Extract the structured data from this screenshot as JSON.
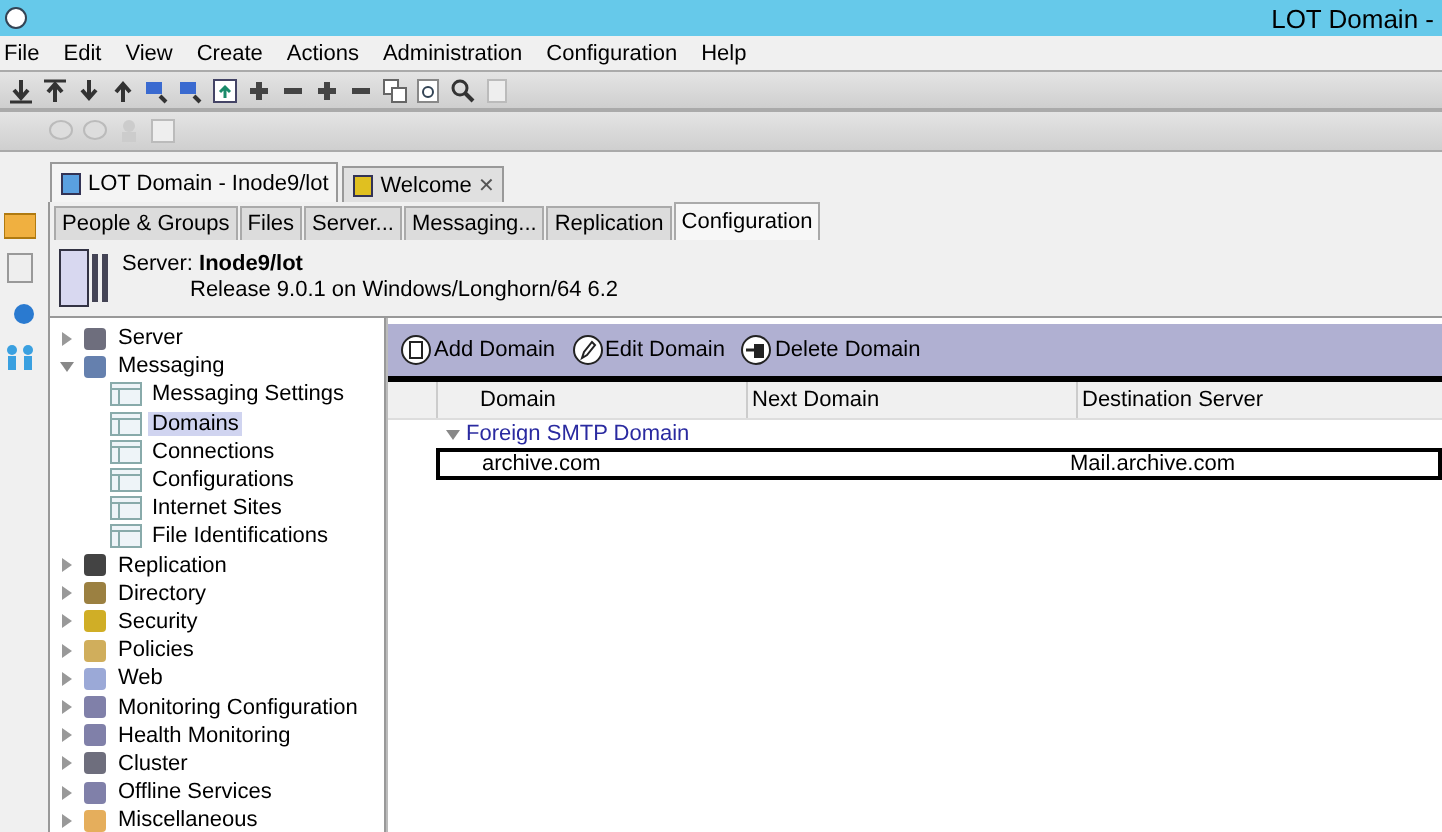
{
  "window": {
    "title": "LOT Domain -"
  },
  "menu": [
    "File",
    "Edit",
    "View",
    "Create",
    "Actions",
    "Administration",
    "Configuration",
    "Help"
  ],
  "doc_tabs": [
    {
      "label": "LOT Domain - Inode9/lot",
      "selected": true
    },
    {
      "label": "Welcome",
      "selected": false,
      "close": "✕"
    }
  ],
  "sub_tabs": [
    {
      "label": "People & Groups",
      "selected": false
    },
    {
      "label": "Files",
      "selected": false
    },
    {
      "label": "Server...",
      "selected": false
    },
    {
      "label": "Messaging...",
      "selected": false
    },
    {
      "label": "Replication",
      "selected": false
    },
    {
      "label": "Configuration",
      "selected": true
    }
  ],
  "server": {
    "label": "Server:",
    "name": "Inode9/lot",
    "release": "Release 9.0.1 on Windows/Longhorn/64 6.2"
  },
  "tree": [
    {
      "label": "Server",
      "expanded": false,
      "selected": false
    },
    {
      "label": "Messaging",
      "expanded": true,
      "selected": false,
      "children": [
        {
          "label": "Messaging Settings",
          "selected": false
        },
        {
          "label": "Domains",
          "selected": true
        },
        {
          "label": "Connections",
          "selected": false
        },
        {
          "label": "Configurations",
          "selected": false
        },
        {
          "label": "Internet Sites",
          "selected": false
        },
        {
          "label": "File Identifications",
          "selected": false
        }
      ]
    },
    {
      "label": "Replication",
      "expanded": false,
      "selected": false
    },
    {
      "label": "Directory",
      "expanded": false,
      "selected": false
    },
    {
      "label": "Security",
      "expanded": false,
      "selected": false
    },
    {
      "label": "Policies",
      "expanded": false,
      "selected": false
    },
    {
      "label": "Web",
      "expanded": false,
      "selected": false
    },
    {
      "label": "Monitoring Configuration",
      "expanded": false,
      "selected": false
    },
    {
      "label": "Health Monitoring",
      "expanded": false,
      "selected": false
    },
    {
      "label": "Cluster",
      "expanded": false,
      "selected": false
    },
    {
      "label": "Offline Services",
      "expanded": false,
      "selected": false
    },
    {
      "label": "Miscellaneous",
      "expanded": false,
      "selected": false
    }
  ],
  "actions": [
    "Add Domain",
    "Edit Domain",
    "Delete Domain"
  ],
  "table": {
    "columns": [
      "Domain",
      "Next Domain",
      "Destination Server"
    ],
    "groups": [
      {
        "label": "Foreign SMTP Domain",
        "expanded": true,
        "rows": [
          {
            "domain": "archive.com",
            "destination_server": "Mail.archive.com",
            "selected": true
          }
        ]
      }
    ]
  }
}
